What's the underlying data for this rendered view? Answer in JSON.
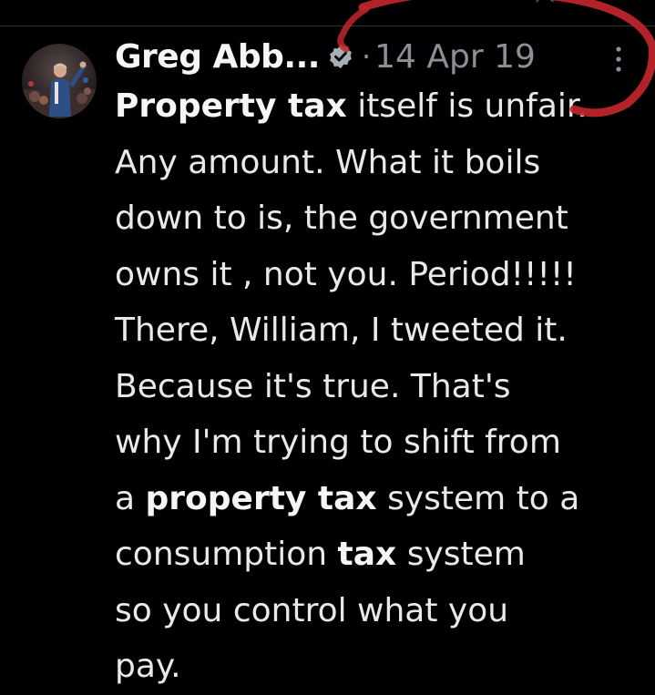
{
  "tweet": {
    "author_name": "Greg Abb...",
    "separator": "·",
    "date": "14 Apr 19",
    "body_lines": [
      [
        {
          "t": "Property tax",
          "b": true
        },
        {
          "t": " itself is unfair.",
          "b": false
        }
      ],
      [
        {
          "t": "Any amount. What it boils",
          "b": false
        }
      ],
      [
        {
          "t": "down to is, the government",
          "b": false
        }
      ],
      [
        {
          "t": "owns it , not you. Period!!!!!",
          "b": false
        }
      ],
      [
        {
          "t": "There, William, I tweeted it.",
          "b": false
        }
      ],
      [
        {
          "t": "Because it's true. That's",
          "b": false
        }
      ],
      [
        {
          "t": "why I'm trying to shift from",
          "b": false
        }
      ],
      [
        {
          "t": "a ",
          "b": false
        },
        {
          "t": "property tax",
          "b": true
        },
        {
          "t": " system to a",
          "b": false
        }
      ],
      [
        {
          "t": "consumption ",
          "b": false
        },
        {
          "t": "tax",
          "b": true
        },
        {
          "t": " system",
          "b": false
        }
      ],
      [
        {
          "t": "so you control what you",
          "b": false
        }
      ],
      [
        {
          "t": "pay.",
          "b": false
        }
      ]
    ]
  },
  "icons": {
    "verified": "verified-badge-icon",
    "more": "more-vertical-icon",
    "avatar": "profile-photo"
  },
  "colors": {
    "background": "#000000",
    "text": "#e7e9ea",
    "muted": "#8b9096",
    "badge": "#a6aeb6",
    "annotation": "#c0262c"
  }
}
